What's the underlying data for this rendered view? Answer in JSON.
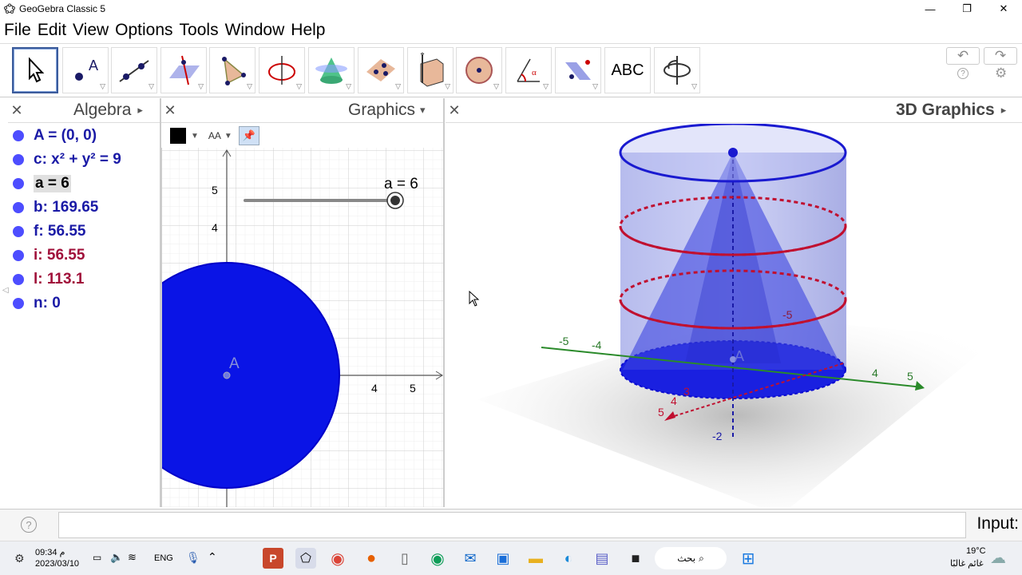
{
  "window": {
    "title": "GeoGebra Classic 5",
    "minimize": "—",
    "maximize": "❐",
    "close": "✕"
  },
  "menu": [
    "File",
    "Edit",
    "View",
    "Options",
    "Tools",
    "Window",
    "Help"
  ],
  "toolbar": {
    "tools": [
      "move-tool",
      "point-tool",
      "line-tool",
      "perpendicular-line-tool",
      "polygon-tool",
      "circle-tool",
      "intersect-tool",
      "plane-tool",
      "pyramid-tool",
      "sphere-tool",
      "angle-tool",
      "reflect-tool",
      "text-tool",
      "rotate-view-tool"
    ],
    "text_tool_label": "ABC",
    "undo": "↶",
    "redo": "↷",
    "help": "?",
    "settings": "⚙"
  },
  "panels": {
    "algebra": {
      "title": "Algebra",
      "arrow": "▸"
    },
    "graphics": {
      "title": "Graphics",
      "arrow": "▾"
    },
    "graphics3d": {
      "title": "3D Graphics",
      "arrow": "▸"
    }
  },
  "algebra_items": [
    {
      "text": "A = (0, 0)",
      "color": "#1a1aa6"
    },
    {
      "text": "c: x² + y² = 9",
      "color": "#1a1aa6"
    },
    {
      "text": "a = 6",
      "color": "#000000",
      "highlight": true
    },
    {
      "text": "b: 169.65",
      "color": "#1a1aa6"
    },
    {
      "text": "f: 56.55",
      "color": "#1a1aa6"
    },
    {
      "text": "i: 56.55",
      "color": "#a0103a"
    },
    {
      "text": "l: 113.1",
      "color": "#a0103a"
    },
    {
      "text": "n: 0",
      "color": "#1a1aa6"
    }
  ],
  "graphics2d": {
    "slider_label": "a = 6",
    "point_label": "A",
    "x_ticks": [
      "4",
      "5"
    ],
    "y_ticks": [
      "5",
      "4"
    ],
    "style_aa": "AA"
  },
  "graphics3d": {
    "point_label": "A",
    "axis_labels": [
      "-5",
      "-4",
      "4",
      "5",
      "-2",
      "5",
      "4",
      "3",
      "-5"
    ]
  },
  "input": {
    "label": "Input:",
    "help": "?"
  },
  "taskbar": {
    "time": "09:34 م",
    "date": "2023/03/10",
    "lang": "ENG",
    "search": "بحث",
    "temp": "19°C",
    "weather": "غائم غالبًا"
  }
}
